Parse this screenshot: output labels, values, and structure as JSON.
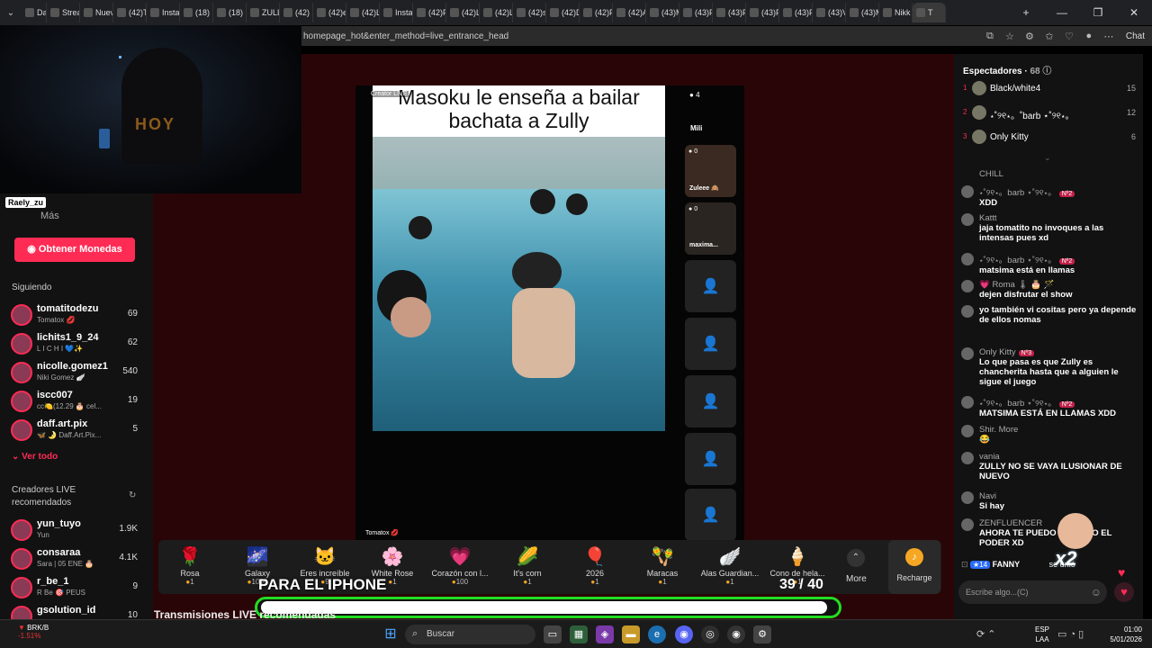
{
  "browser": {
    "tabs": [
      "Dash",
      "Strea",
      "Nuev",
      "(42)T",
      "Insta",
      "(18) I",
      "(18) I",
      "ZULL",
      "(42) X",
      "(42)e",
      "(42)L",
      "Insta",
      "(42)F",
      "(42)L",
      "(42)L",
      "(42)s",
      "(42)D",
      "(42)F",
      "(42)A",
      "(43)M",
      "(43)F",
      "(43)F",
      "(43)F",
      "(43)F",
      "(43)V",
      "(43)M",
      "Nikk",
      "T"
    ],
    "url": "homepage_hot&enter_method=live_entrance_head",
    "chat_label": "Chat"
  },
  "webcam": {
    "overlay_text": "HOY"
  },
  "left_nav": {
    "streamer_badge": "Raely_zu",
    "more_label": "Más",
    "coins_button": "Obtener Monedas",
    "following_header": "Siguiendo",
    "following": [
      {
        "name": "tomatitodezu",
        "sub": "Tomatox 💋",
        "count": "69"
      },
      {
        "name": "lichits1_9_24",
        "sub": "L I C H I 💙✨",
        "count": "62"
      },
      {
        "name": "nicolle.gomez1",
        "sub": "Niki Gomez 🪽",
        "count": "540"
      },
      {
        "name": "iscc007",
        "sub": "cc🍋(12.29 🎂 cel...",
        "count": "19"
      },
      {
        "name": "daff.art.pix",
        "sub": "🦋 🌛 Daff.Art.Pix...",
        "count": "5"
      }
    ],
    "see_all": "Ver todo",
    "recommended_header": "Creadores LIVE recomendados",
    "recommended": [
      {
        "name": "yun_tuyo",
        "sub": "Yun",
        "count": "1.9K"
      },
      {
        "name": "consaraa",
        "sub": "Sara | 05 ENE 🎂",
        "count": "4.1K"
      },
      {
        "name": "r_be_1",
        "sub": "R Be 🎯 PEUS",
        "count": "9"
      },
      {
        "name": "gsolution_id",
        "sub": "",
        "count": "10"
      }
    ]
  },
  "video": {
    "title_line1": "Masoku le enseña a bailar",
    "title_line2": "bachata a Zully",
    "watermark": "Creator LIVE",
    "host_tag": "Tomatox 💋"
  },
  "guests": [
    {
      "count": "4",
      "name": "Mili"
    },
    {
      "count": "0",
      "name": "Zuleee 🙈"
    },
    {
      "count": "0",
      "name": "maxima..."
    }
  ],
  "gifts": [
    {
      "icon": "🌹",
      "name": "Rosa",
      "price": "1"
    },
    {
      "icon": "🌌",
      "name": "Galaxy",
      "price": "1000"
    },
    {
      "icon": "🐱",
      "name": "Eres increíble",
      "price": "9"
    },
    {
      "icon": "🌸",
      "name": "White Rose",
      "price": "1"
    },
    {
      "icon": "💗",
      "name": "Corazón con l...",
      "price": "100"
    },
    {
      "icon": "🌽",
      "name": "It's corn",
      "price": "1"
    },
    {
      "icon": "🎈",
      "name": "2026",
      "price": "1"
    },
    {
      "icon": "🪇",
      "name": "Maracas",
      "price": "1"
    },
    {
      "icon": "🪽",
      "name": "Alas Guardian...",
      "price": "1"
    },
    {
      "icon": "🍦",
      "name": "Cono de hela...",
      "price": "1"
    }
  ],
  "gift_more": "More",
  "recharge": "Recharge",
  "stream_overlay": {
    "goal_text": "PARA EL IPHONE",
    "goal_count": "39 / 40"
  },
  "recommended_streams_label": "Transmisiones LIVE recomendadas",
  "viewers": {
    "header": "Espectadores",
    "count": "68",
    "top": [
      {
        "rank": "1",
        "name": "Black/white4",
        "score": "15"
      },
      {
        "rank": "2",
        "name": "⋆˚୨୧⋆。˚barb ⋆˚୨୧⋆。",
        "score": "12"
      },
      {
        "rank": "3",
        "name": "Only Kitty",
        "score": "6"
      }
    ]
  },
  "chat": {
    "messages": [
      {
        "user": "CHILL",
        "badge": "",
        "text": ""
      },
      {
        "user": "⋆˚୨୧⋆。barb ⋆˚୨୧⋆。",
        "badge": "Nº2",
        "text": "XDD"
      },
      {
        "user": "Kattt",
        "badge": "",
        "text": "jaja tomatito no invoques a las intensas pues xd"
      },
      {
        "user": "⋆˚୨୧⋆。barb ⋆˚୨୧⋆。",
        "badge": "Nº2",
        "text": "matsima está en llamas"
      },
      {
        "user": "💗 Roma 🌡 🎂 🪄",
        "badge": "",
        "text": "dejen disfrutar el show"
      },
      {
        "user": "",
        "badge": "",
        "text": "yo también vi cositas pero ya depende de ellos nomas"
      },
      {
        "user": "Only Kitty",
        "badge": "Nº3",
        "text": "Lo que pasa es que Zully es chancherita hasta que a alguien le sigue el juego"
      },
      {
        "user": "⋆˚୨୧⋆。barb ⋆˚୨୧⋆。",
        "badge": "Nº2",
        "text": "MATSIMA ESTÁ EN LLAMAS XDD"
      },
      {
        "user": "Shir. More",
        "badge": "",
        "text": "😂"
      },
      {
        "user": "vania",
        "badge": "",
        "text": "ZULLY NO SE VAYA ILUSIONAR DE NUEVO"
      },
      {
        "user": "Navi",
        "badge": "",
        "text": "Si hay"
      },
      {
        "user": "ZENFLUENCER",
        "badge": "",
        "text": "AHORA TE PUEDO ... TENGO EL PODER XD"
      }
    ],
    "join_notice": {
      "level": "14",
      "user": "FANNY",
      "text": "se unió"
    },
    "combo": "x2",
    "input_placeholder": "Escribe algo...(C)"
  },
  "taskbar": {
    "stock_ticker": "BRK/B",
    "stock_change": "-1.51%",
    "search": "Buscar",
    "lang1": "ESP",
    "lang2": "LAA",
    "time": "01:00",
    "date": "5/01/2026"
  },
  "colors": {
    "accent": "#fe2c55",
    "stage_bg": "#2a0508",
    "goal_outline": "#22dd22"
  }
}
